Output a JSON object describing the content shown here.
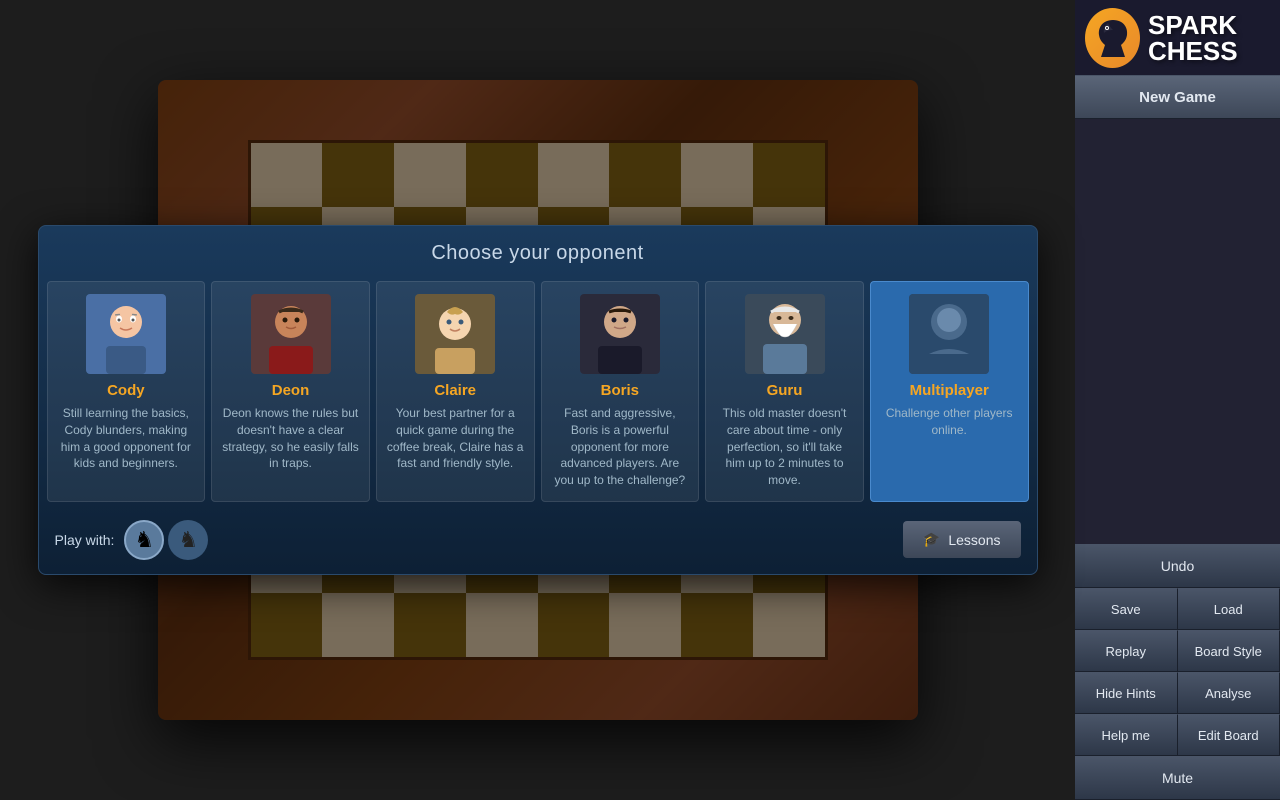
{
  "app": {
    "title_spark": "SPARK",
    "title_chess": "CHESS"
  },
  "sidebar": {
    "new_game_label": "New Game",
    "undo_label": "Undo",
    "save_label": "Save",
    "load_label": "Load",
    "replay_label": "Replay",
    "board_style_label": "Board Style",
    "hide_hints_label": "Hide Hints",
    "analyse_label": "Analyse",
    "help_me_label": "Help me",
    "edit_board_label": "Edit Board",
    "mute_label": "Mute"
  },
  "modal": {
    "title": "Choose your opponent",
    "play_with_label": "Play with:",
    "lessons_label": "Lessons",
    "opponents": [
      {
        "id": "cody",
        "name": "Cody",
        "desc": "Still learning the basics, Cody blunders, making him a good opponent for kids and beginners.",
        "selected": false
      },
      {
        "id": "deon",
        "name": "Deon",
        "desc": "Deon knows the rules but doesn't have a clear strategy, so he easily falls in traps.",
        "selected": false
      },
      {
        "id": "claire",
        "name": "Claire",
        "desc": "Your best partner for a quick game during the coffee break, Claire has a fast and friendly style.",
        "selected": false
      },
      {
        "id": "boris",
        "name": "Boris",
        "desc": "Fast and aggressive, Boris is a powerful opponent for more advanced players. Are you up to the challenge?",
        "selected": false
      },
      {
        "id": "guru",
        "name": "Guru",
        "desc": "This old master doesn't care about time - only perfection, so it'll take him up to 2 minutes to move.",
        "selected": false
      },
      {
        "id": "multiplayer",
        "name": "Multiplayer",
        "desc": "Challenge other players online.",
        "selected": true
      }
    ]
  }
}
